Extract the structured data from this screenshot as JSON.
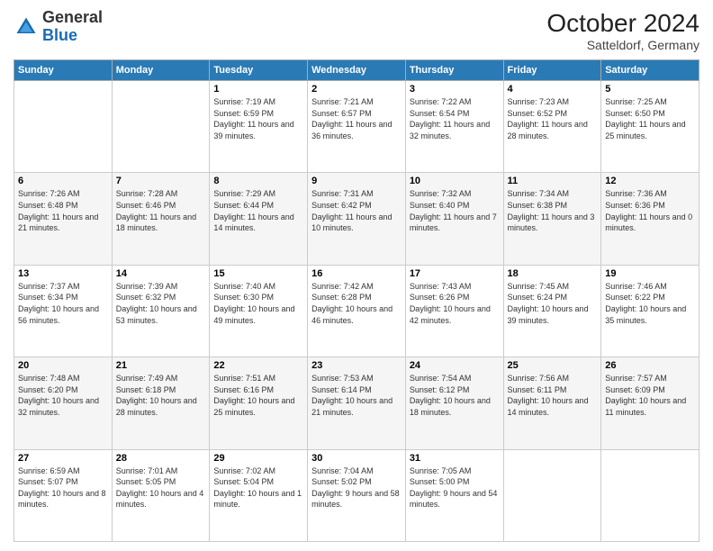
{
  "header": {
    "logo_general": "General",
    "logo_blue": "Blue",
    "month": "October 2024",
    "location": "Satteldorf, Germany"
  },
  "weekdays": [
    "Sunday",
    "Monday",
    "Tuesday",
    "Wednesday",
    "Thursday",
    "Friday",
    "Saturday"
  ],
  "weeks": [
    [
      {
        "day": "",
        "sunrise": "",
        "sunset": "",
        "daylight": ""
      },
      {
        "day": "",
        "sunrise": "",
        "sunset": "",
        "daylight": ""
      },
      {
        "day": "1",
        "sunrise": "Sunrise: 7:19 AM",
        "sunset": "Sunset: 6:59 PM",
        "daylight": "Daylight: 11 hours and 39 minutes."
      },
      {
        "day": "2",
        "sunrise": "Sunrise: 7:21 AM",
        "sunset": "Sunset: 6:57 PM",
        "daylight": "Daylight: 11 hours and 36 minutes."
      },
      {
        "day": "3",
        "sunrise": "Sunrise: 7:22 AM",
        "sunset": "Sunset: 6:54 PM",
        "daylight": "Daylight: 11 hours and 32 minutes."
      },
      {
        "day": "4",
        "sunrise": "Sunrise: 7:23 AM",
        "sunset": "Sunset: 6:52 PM",
        "daylight": "Daylight: 11 hours and 28 minutes."
      },
      {
        "day": "5",
        "sunrise": "Sunrise: 7:25 AM",
        "sunset": "Sunset: 6:50 PM",
        "daylight": "Daylight: 11 hours and 25 minutes."
      }
    ],
    [
      {
        "day": "6",
        "sunrise": "Sunrise: 7:26 AM",
        "sunset": "Sunset: 6:48 PM",
        "daylight": "Daylight: 11 hours and 21 minutes."
      },
      {
        "day": "7",
        "sunrise": "Sunrise: 7:28 AM",
        "sunset": "Sunset: 6:46 PM",
        "daylight": "Daylight: 11 hours and 18 minutes."
      },
      {
        "day": "8",
        "sunrise": "Sunrise: 7:29 AM",
        "sunset": "Sunset: 6:44 PM",
        "daylight": "Daylight: 11 hours and 14 minutes."
      },
      {
        "day": "9",
        "sunrise": "Sunrise: 7:31 AM",
        "sunset": "Sunset: 6:42 PM",
        "daylight": "Daylight: 11 hours and 10 minutes."
      },
      {
        "day": "10",
        "sunrise": "Sunrise: 7:32 AM",
        "sunset": "Sunset: 6:40 PM",
        "daylight": "Daylight: 11 hours and 7 minutes."
      },
      {
        "day": "11",
        "sunrise": "Sunrise: 7:34 AM",
        "sunset": "Sunset: 6:38 PM",
        "daylight": "Daylight: 11 hours and 3 minutes."
      },
      {
        "day": "12",
        "sunrise": "Sunrise: 7:36 AM",
        "sunset": "Sunset: 6:36 PM",
        "daylight": "Daylight: 11 hours and 0 minutes."
      }
    ],
    [
      {
        "day": "13",
        "sunrise": "Sunrise: 7:37 AM",
        "sunset": "Sunset: 6:34 PM",
        "daylight": "Daylight: 10 hours and 56 minutes."
      },
      {
        "day": "14",
        "sunrise": "Sunrise: 7:39 AM",
        "sunset": "Sunset: 6:32 PM",
        "daylight": "Daylight: 10 hours and 53 minutes."
      },
      {
        "day": "15",
        "sunrise": "Sunrise: 7:40 AM",
        "sunset": "Sunset: 6:30 PM",
        "daylight": "Daylight: 10 hours and 49 minutes."
      },
      {
        "day": "16",
        "sunrise": "Sunrise: 7:42 AM",
        "sunset": "Sunset: 6:28 PM",
        "daylight": "Daylight: 10 hours and 46 minutes."
      },
      {
        "day": "17",
        "sunrise": "Sunrise: 7:43 AM",
        "sunset": "Sunset: 6:26 PM",
        "daylight": "Daylight: 10 hours and 42 minutes."
      },
      {
        "day": "18",
        "sunrise": "Sunrise: 7:45 AM",
        "sunset": "Sunset: 6:24 PM",
        "daylight": "Daylight: 10 hours and 39 minutes."
      },
      {
        "day": "19",
        "sunrise": "Sunrise: 7:46 AM",
        "sunset": "Sunset: 6:22 PM",
        "daylight": "Daylight: 10 hours and 35 minutes."
      }
    ],
    [
      {
        "day": "20",
        "sunrise": "Sunrise: 7:48 AM",
        "sunset": "Sunset: 6:20 PM",
        "daylight": "Daylight: 10 hours and 32 minutes."
      },
      {
        "day": "21",
        "sunrise": "Sunrise: 7:49 AM",
        "sunset": "Sunset: 6:18 PM",
        "daylight": "Daylight: 10 hours and 28 minutes."
      },
      {
        "day": "22",
        "sunrise": "Sunrise: 7:51 AM",
        "sunset": "Sunset: 6:16 PM",
        "daylight": "Daylight: 10 hours and 25 minutes."
      },
      {
        "day": "23",
        "sunrise": "Sunrise: 7:53 AM",
        "sunset": "Sunset: 6:14 PM",
        "daylight": "Daylight: 10 hours and 21 minutes."
      },
      {
        "day": "24",
        "sunrise": "Sunrise: 7:54 AM",
        "sunset": "Sunset: 6:12 PM",
        "daylight": "Daylight: 10 hours and 18 minutes."
      },
      {
        "day": "25",
        "sunrise": "Sunrise: 7:56 AM",
        "sunset": "Sunset: 6:11 PM",
        "daylight": "Daylight: 10 hours and 14 minutes."
      },
      {
        "day": "26",
        "sunrise": "Sunrise: 7:57 AM",
        "sunset": "Sunset: 6:09 PM",
        "daylight": "Daylight: 10 hours and 11 minutes."
      }
    ],
    [
      {
        "day": "27",
        "sunrise": "Sunrise: 6:59 AM",
        "sunset": "Sunset: 5:07 PM",
        "daylight": "Daylight: 10 hours and 8 minutes."
      },
      {
        "day": "28",
        "sunrise": "Sunrise: 7:01 AM",
        "sunset": "Sunset: 5:05 PM",
        "daylight": "Daylight: 10 hours and 4 minutes."
      },
      {
        "day": "29",
        "sunrise": "Sunrise: 7:02 AM",
        "sunset": "Sunset: 5:04 PM",
        "daylight": "Daylight: 10 hours and 1 minute."
      },
      {
        "day": "30",
        "sunrise": "Sunrise: 7:04 AM",
        "sunset": "Sunset: 5:02 PM",
        "daylight": "Daylight: 9 hours and 58 minutes."
      },
      {
        "day": "31",
        "sunrise": "Sunrise: 7:05 AM",
        "sunset": "Sunset: 5:00 PM",
        "daylight": "Daylight: 9 hours and 54 minutes."
      },
      {
        "day": "",
        "sunrise": "",
        "sunset": "",
        "daylight": ""
      },
      {
        "day": "",
        "sunrise": "",
        "sunset": "",
        "daylight": ""
      }
    ]
  ]
}
